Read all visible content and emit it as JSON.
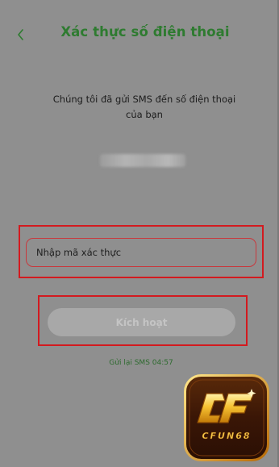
{
  "header": {
    "title": "Xác thực số điện thoại",
    "back_icon": "chevron-left-icon"
  },
  "message": {
    "text": "Chúng tôi đã gửi SMS đến số điện thoại của bạn"
  },
  "verification": {
    "code_placeholder": "Nhập mã xác thực",
    "code_value": ""
  },
  "activate": {
    "label": "Kích hoạt"
  },
  "resend": {
    "text": "Gửi lại SMS 04:57"
  },
  "watermark": {
    "text": "CFUN68"
  },
  "colors": {
    "background": "#8f8f8f",
    "title": "#2e7b30",
    "highlight": "#d31a1f",
    "button": "#a8a8a8",
    "button_text": "#c4c4c4"
  }
}
